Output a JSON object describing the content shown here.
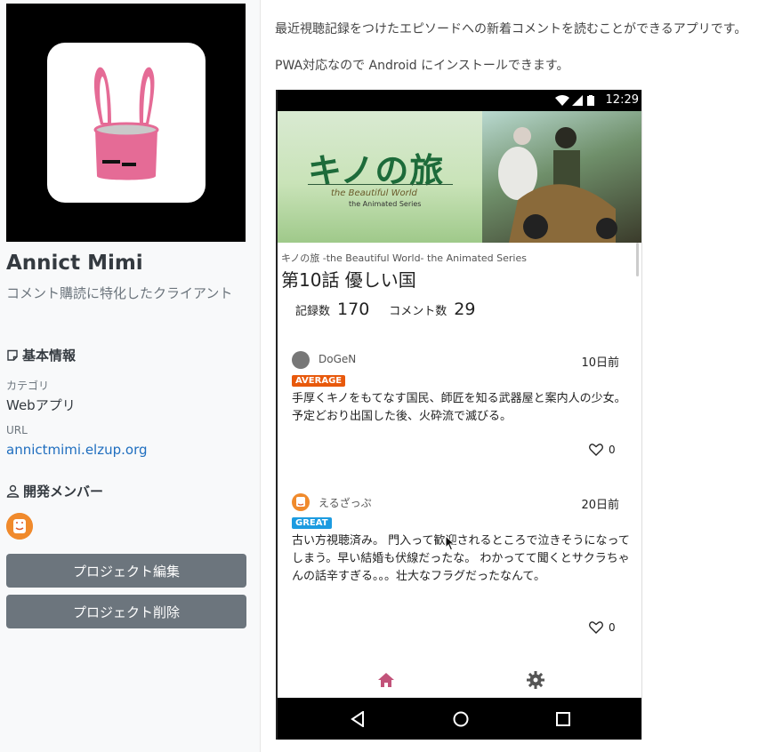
{
  "project": {
    "name": "Annict Mimi",
    "description": "コメント購読に特化したクライアント"
  },
  "info": {
    "heading": "基本情報",
    "category_label": "カテゴリ",
    "category_value": "Webアプリ",
    "url_label": "URL",
    "url_value": "annictmimi.elzup.org"
  },
  "members": {
    "heading": "開発メンバー"
  },
  "buttons": {
    "edit": "プロジェクト編集",
    "delete": "プロジェクト削除"
  },
  "content": {
    "para1": "最近視聴記録をつけたエピソードへの新着コメントを読むことができるアプリです。",
    "para2": "PWA対応なので Android にインストールできます。"
  },
  "phone": {
    "time": "12:29",
    "banner_title": "キノの旅",
    "banner_sub1": "the Beautiful World",
    "banner_sub2": "the Animated Series",
    "series": "キノの旅 -the Beautiful World- the Animated Series",
    "episode": "第10話 優しい国",
    "records_label": "記録数",
    "records_value": "170",
    "comments_label": "コメント数",
    "comments_value": "29",
    "comments": [
      {
        "user": "DoGeN",
        "time": "10日前",
        "badge": "AVERAGE",
        "text": "手厚くキノをもてなす国民、師匠を知る武器屋と案内人の少女。 予定どおり出国した後、火砕流で滅びる。",
        "likes": "0"
      },
      {
        "user": "えるざっぷ",
        "time": "20日前",
        "badge": "GREAT",
        "text": "古い方視聴済み。 門入って歓迎されるところで泣きそうになってしまう。早い結婚も伏線だったな。 わかってて聞くとサクラちゃんの話辛すぎる。。。壮大なフラグだったなんて。",
        "likes": "0"
      }
    ]
  },
  "colors": {
    "secondary_button": "#6c757d",
    "link": "#1f6ebf",
    "badge_average": "#e8590c",
    "badge_great": "#1c9be0",
    "nav_home_active": "#c2537a",
    "nav_settings": "#555555"
  }
}
